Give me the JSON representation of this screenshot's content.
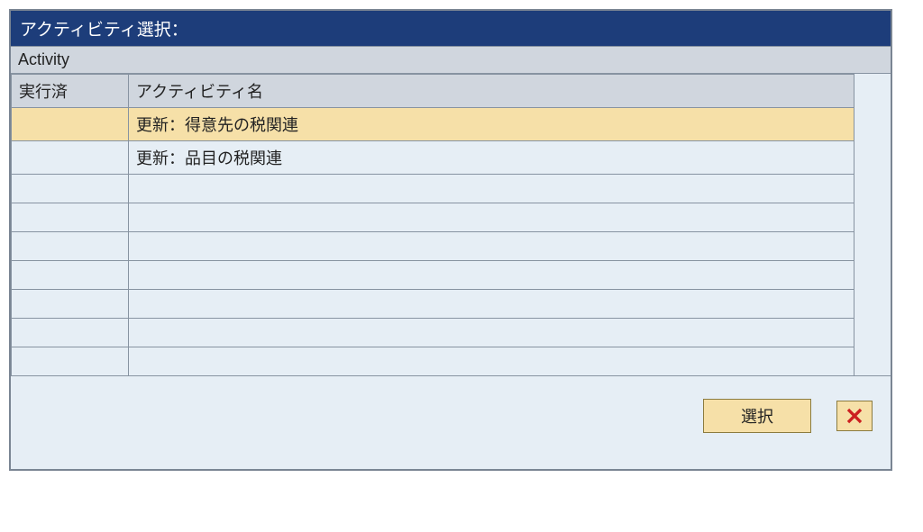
{
  "dialog": {
    "title": "アクティビティ選択：",
    "group_label": "Activity",
    "columns": {
      "status": "実行済",
      "name": "アクティビティ名"
    },
    "rows": [
      {
        "status": "",
        "name": "更新：得意先の税関連",
        "selected": true
      },
      {
        "status": "",
        "name": "更新：品目の税関連",
        "selected": false
      },
      {
        "status": "",
        "name": "",
        "selected": false
      },
      {
        "status": "",
        "name": "",
        "selected": false
      },
      {
        "status": "",
        "name": "",
        "selected": false
      },
      {
        "status": "",
        "name": "",
        "selected": false
      },
      {
        "status": "",
        "name": "",
        "selected": false
      },
      {
        "status": "",
        "name": "",
        "selected": false
      },
      {
        "status": "",
        "name": "",
        "selected": false
      }
    ],
    "buttons": {
      "select": "選択"
    }
  }
}
